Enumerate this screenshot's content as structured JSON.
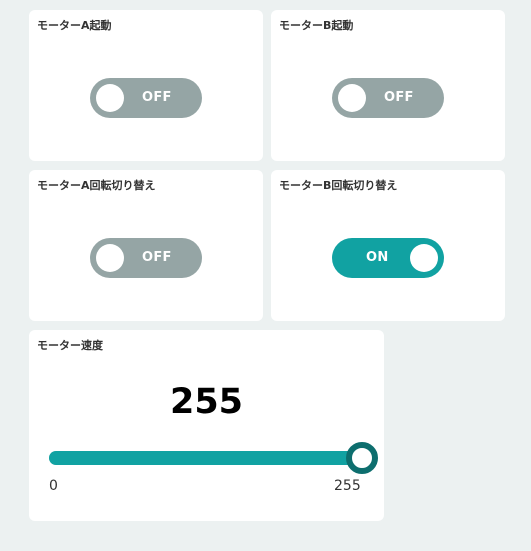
{
  "colors": {
    "background": "#ecf1f1",
    "card": "#ffffff",
    "toggle_off": "#95a5a5",
    "toggle_on": "#11a2a2",
    "slider_fill": "#11a2a2",
    "slider_thumb_border": "#0d6e6e"
  },
  "widgets": {
    "motor_a_start": {
      "title": "モーターA起動",
      "state": "OFF",
      "on": false
    },
    "motor_b_start": {
      "title": "モーターB起動",
      "state": "OFF",
      "on": false
    },
    "motor_a_direction": {
      "title": "モーターA回転切り替え",
      "state": "OFF",
      "on": false
    },
    "motor_b_direction": {
      "title": "モーターB回転切り替え",
      "state": "ON",
      "on": true
    }
  },
  "speed": {
    "title": "モーター速度",
    "value": "255",
    "min": "0",
    "max": "255",
    "level": 1.0
  }
}
